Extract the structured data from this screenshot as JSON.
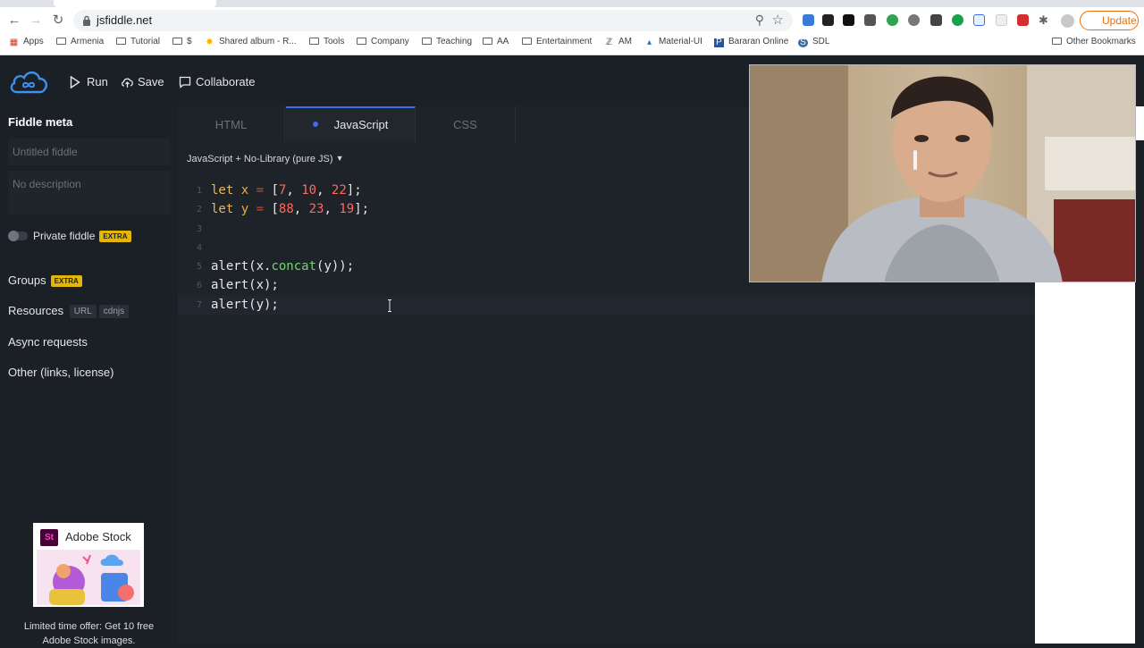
{
  "browser": {
    "url": "jsfiddle.net",
    "update_label": "Update",
    "bookmarks": [
      {
        "label": "Apps"
      },
      {
        "label": "Armenia"
      },
      {
        "label": "Tutorial"
      },
      {
        "label": "$"
      },
      {
        "label": "Shared album - R..."
      },
      {
        "label": "Tools"
      },
      {
        "label": "Company"
      },
      {
        "label": "Teaching"
      },
      {
        "label": "AA"
      },
      {
        "label": "Entertainment"
      },
      {
        "label": "AM"
      },
      {
        "label": "Material-UI"
      },
      {
        "label": "Bararan Online"
      },
      {
        "label": "SDL"
      },
      {
        "label": "Other Bookmarks"
      }
    ]
  },
  "header": {
    "run_label": "Run",
    "save_label": "Save",
    "collaborate_label": "Collaborate"
  },
  "sidebar": {
    "title": "Fiddle meta",
    "title_placeholder": "Untitled fiddle",
    "description_placeholder": "No description",
    "private_label": "Private fiddle",
    "extra_badge": "EXTRA",
    "groups_label": "Groups",
    "resources_label": "Resources",
    "resources_tags": [
      "URL",
      "cdnjs"
    ],
    "async_label": "Async requests",
    "other_label": "Other (links, license)",
    "ad_brand": "Adobe Stock",
    "ad_brand_icon": "St",
    "ad_text": "Limited time offer: Get 10 free Adobe Stock images."
  },
  "editor": {
    "tabs": [
      {
        "label": "HTML",
        "active": false
      },
      {
        "label": "JavaScript",
        "active": true
      },
      {
        "label": "CSS",
        "active": false
      }
    ],
    "language_select": "JavaScript + No-Library (pure JS)",
    "language_caret": "▼",
    "lines": [
      {
        "n": "1",
        "code": "let x = [7, 10, 22];"
      },
      {
        "n": "2",
        "code": "let y = [88, 23, 19];"
      },
      {
        "n": "3",
        "code": ""
      },
      {
        "n": "4",
        "code": ""
      },
      {
        "n": "5",
        "code": "alert(x.concat(y));"
      },
      {
        "n": "6",
        "code": "alert(x);"
      },
      {
        "n": "7",
        "code": "alert(y);"
      }
    ],
    "current_line": 7
  },
  "colors": {
    "accent": "#3d6cf2",
    "extra_badge": "#e3b505",
    "update": "#e8710a"
  }
}
